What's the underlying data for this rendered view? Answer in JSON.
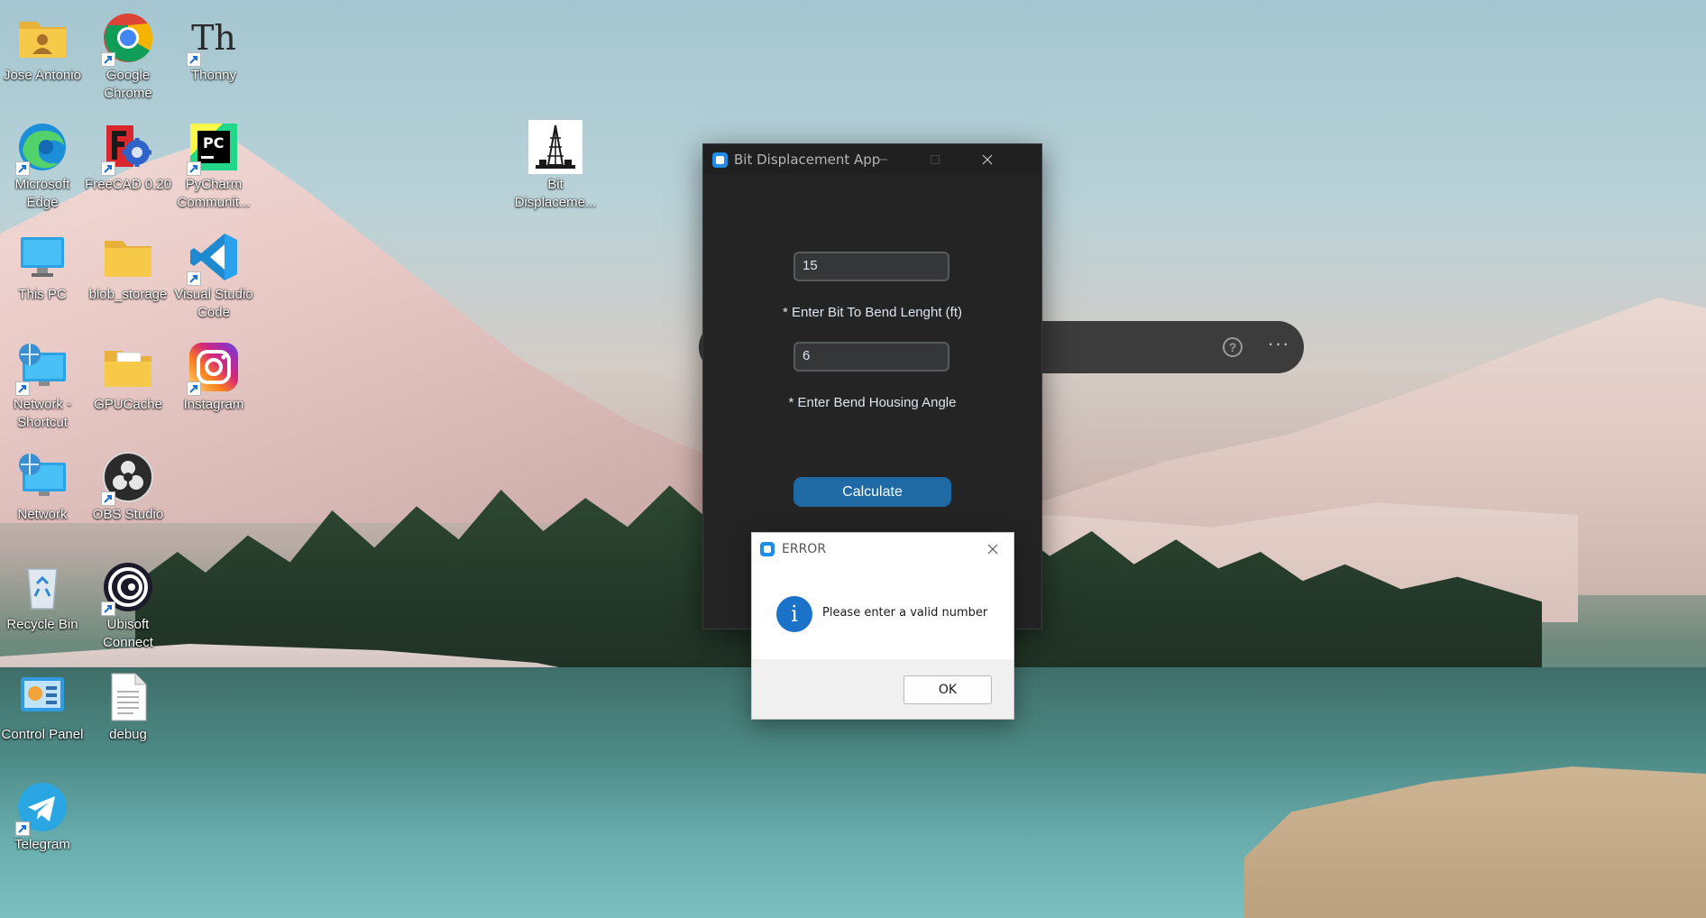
{
  "desktop": {
    "icons": [
      {
        "label": "Jose Antonio"
      },
      {
        "label": "Google Chrome"
      },
      {
        "label": "Thonny"
      },
      {
        "label": "Microsoft Edge"
      },
      {
        "label": "FreeCAD 0.20"
      },
      {
        "label": "PyCharm Communit..."
      },
      {
        "label": "Bit Displaceme..."
      },
      {
        "label": "This PC"
      },
      {
        "label": "blob_storage"
      },
      {
        "label": "Visual Studio Code"
      },
      {
        "label": "Network - Shortcut"
      },
      {
        "label": "GPUCache"
      },
      {
        "label": "Instagram"
      },
      {
        "label": "Network"
      },
      {
        "label": "OBS Studio"
      },
      {
        "label": "Recycle Bin"
      },
      {
        "label": "Ubisoft Connect"
      },
      {
        "label": "Control Panel"
      },
      {
        "label": "debug"
      },
      {
        "label": "Telegram"
      }
    ],
    "thonny_glyph": "Th",
    "pycharm_glyph": "PC"
  },
  "search_widget": {
    "help_glyph": "?",
    "more_glyph": "···"
  },
  "app": {
    "title": "Bit Displacement App",
    "length_input_value": "15",
    "length_label": "* Enter Bit To Bend Lenght (ft)",
    "angle_input_value": "6",
    "angle_label": "* Enter Bend Housing Angle",
    "calculate_label": "Calculate",
    "accent_color": "#1f6aa5"
  },
  "error_dialog": {
    "title": "ERROR",
    "info_glyph": "i",
    "message": "Please enter a valid number",
    "ok_label": "OK"
  }
}
